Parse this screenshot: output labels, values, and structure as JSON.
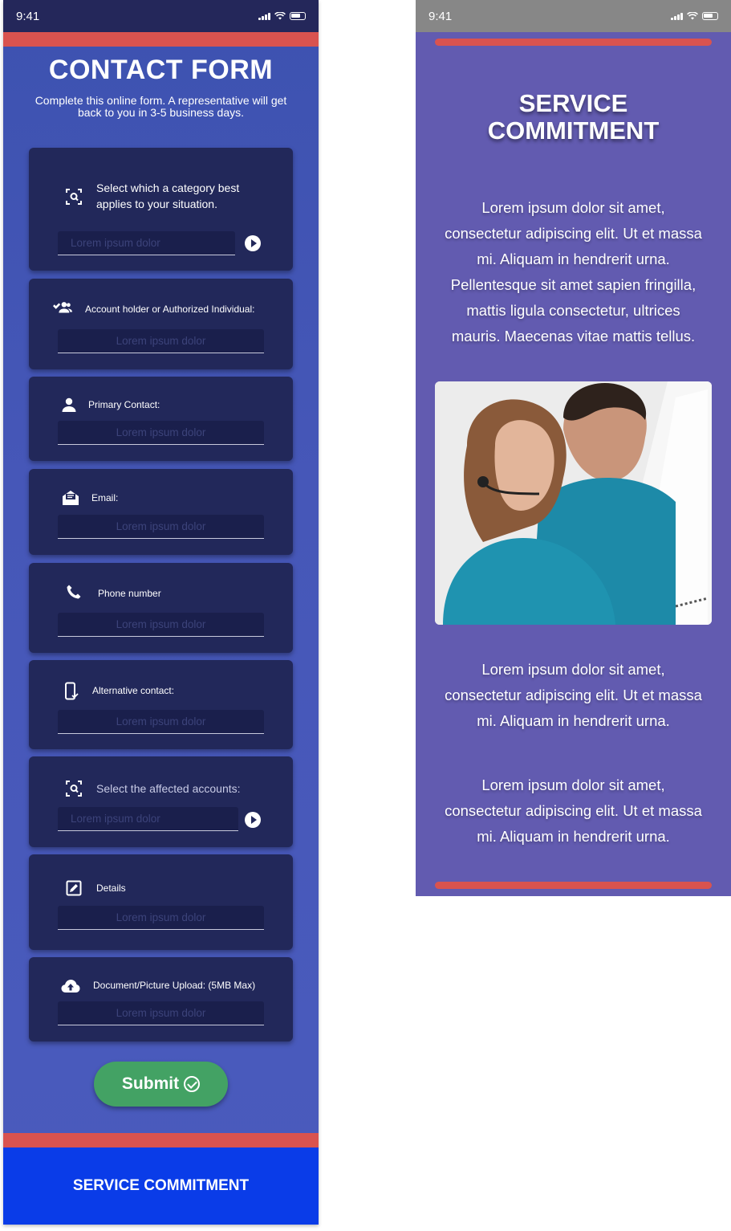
{
  "left": {
    "status_time": "9:41",
    "title": "CONTACT FORM",
    "subtitle": "Complete this online form. A representative will get back to you in 3-5 business days.",
    "cards": [
      {
        "label": "Select which a category best applies to your situation.",
        "placeholder": "Lorem ipsum dolor",
        "icon": "scan-search-icon"
      },
      {
        "label": "Account holder or Authorized Individual:",
        "placeholder": "Lorem ipsum dolor",
        "icon": "users-check-icon"
      },
      {
        "label": "Primary Contact:",
        "placeholder": "Lorem ipsum dolor",
        "icon": "person-icon"
      },
      {
        "label": "Email:",
        "placeholder": "Lorem ipsum dolor",
        "icon": "open-mail-icon"
      },
      {
        "label": "Phone number",
        "placeholder": "Lorem ipsum dolor",
        "icon": "phone-icon"
      },
      {
        "label": "Alternative contact:",
        "placeholder": "Lorem ipsum dolor",
        "icon": "mobile-check-icon"
      },
      {
        "label": "Select the affected accounts:",
        "placeholder": "Lorem ipsum dolor",
        "icon": "scan-search-icon"
      },
      {
        "label": "Details",
        "placeholder": "Lorem ipsum dolor",
        "icon": "edit-square-icon"
      },
      {
        "label": "Document/Picture  Upload: (5MB Max)",
        "placeholder": "Lorem ipsum dolor",
        "icon": "cloud-upload-icon"
      }
    ],
    "submit_label": "Submit",
    "footer_label": "SERVICE COMMITMENT"
  },
  "right": {
    "status_time": "9:41",
    "title": "SERVICE COMMITMENT",
    "paragraph1": "Lorem ipsum dolor sit amet, consectetur adipiscing elit. Ut et massa mi. Aliquam in hendrerit urna. Pellentesque sit amet sapien fringilla, mattis ligula consectetur, ultrices mauris. Maecenas vitae mattis tellus.",
    "paragraph2": "Lorem ipsum dolor sit amet, consectetur adipiscing elit. Ut et massa mi. Aliquam in hendrerit urna.",
    "paragraph3": "Lorem ipsum dolor sit amet, consectetur adipiscing elit. Ut et massa mi. Aliquam in hendrerit urna."
  },
  "colors": {
    "accent_red": "#d9534f",
    "card_navy": "#22285a",
    "submit_green": "#43a264",
    "footer_blue": "#0a3ce8",
    "right_purple": "#625bb0"
  }
}
